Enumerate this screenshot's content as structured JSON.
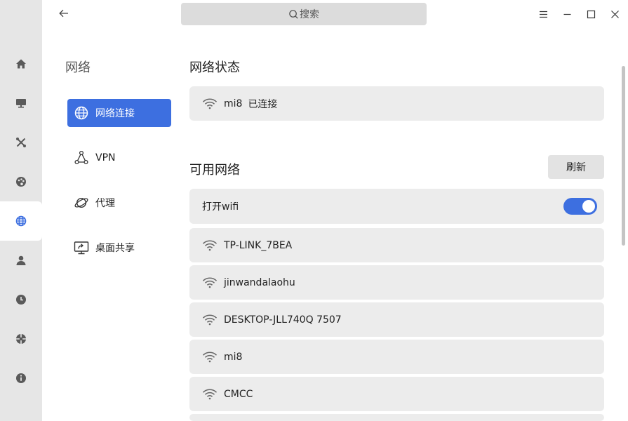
{
  "header": {
    "search_placeholder": "搜索"
  },
  "rail": {
    "items": [
      {
        "icon": "home-icon"
      },
      {
        "icon": "display-icon"
      },
      {
        "icon": "tools-icon"
      },
      {
        "icon": "palette-icon"
      },
      {
        "icon": "network-icon",
        "active": true
      },
      {
        "icon": "user-icon"
      },
      {
        "icon": "clock-icon"
      },
      {
        "icon": "update-icon"
      },
      {
        "icon": "info-icon"
      }
    ]
  },
  "subnav": {
    "title": "网络",
    "items": [
      {
        "label": "网络连接",
        "icon": "globe-network-icon",
        "active": true
      },
      {
        "label": "VPN",
        "icon": "vpn-icon"
      },
      {
        "label": "代理",
        "icon": "proxy-planet-icon"
      },
      {
        "label": "桌面共享",
        "icon": "screen-share-icon"
      }
    ]
  },
  "status": {
    "title": "网络状态",
    "ssid": "mi8",
    "state": "已连接"
  },
  "available": {
    "title": "可用网络",
    "refresh_label": "刷新",
    "wifi_toggle_label": "打开wifi",
    "wifi_enabled": true,
    "networks": [
      "TP-LINK_7BEA",
      "jinwandalaohu",
      "DESKTOP-JLL740Q 7507",
      "mi8",
      "CMCC"
    ]
  },
  "colors": {
    "accent": "#3d6fe0",
    "rail_bg": "#e6e6e6",
    "card_bg": "#ececec"
  }
}
